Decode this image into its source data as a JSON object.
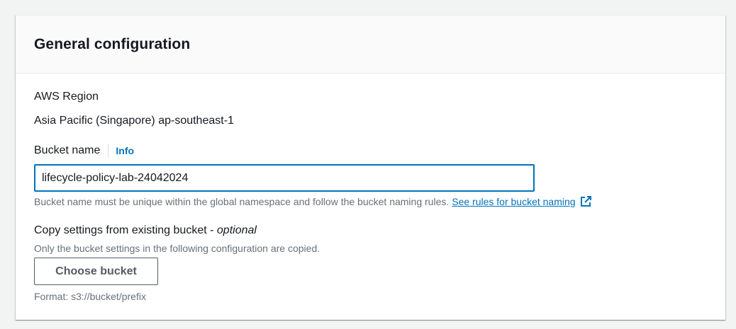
{
  "section": {
    "title": "General configuration"
  },
  "region": {
    "label": "AWS Region",
    "value": "Asia Pacific (Singapore) ap-southeast-1"
  },
  "bucket_name": {
    "label": "Bucket name",
    "info_label": "Info",
    "value": "lifecycle-policy-lab-24042024",
    "help_text": "Bucket name must be unique within the global namespace and follow the bucket naming rules.",
    "rules_link": "See rules for bucket naming"
  },
  "copy_settings": {
    "label": "Copy settings from existing bucket - ",
    "optional": "optional",
    "description": "Only the bucket settings in the following configuration are copied.",
    "button_label": "Choose bucket",
    "format_text": "Format: s3://bucket/prefix"
  },
  "colors": {
    "link": "#0073bb",
    "input_focus_border": "#0073bb",
    "secondary_text": "#687078"
  },
  "icons": {
    "external_link": "external-link-icon"
  }
}
